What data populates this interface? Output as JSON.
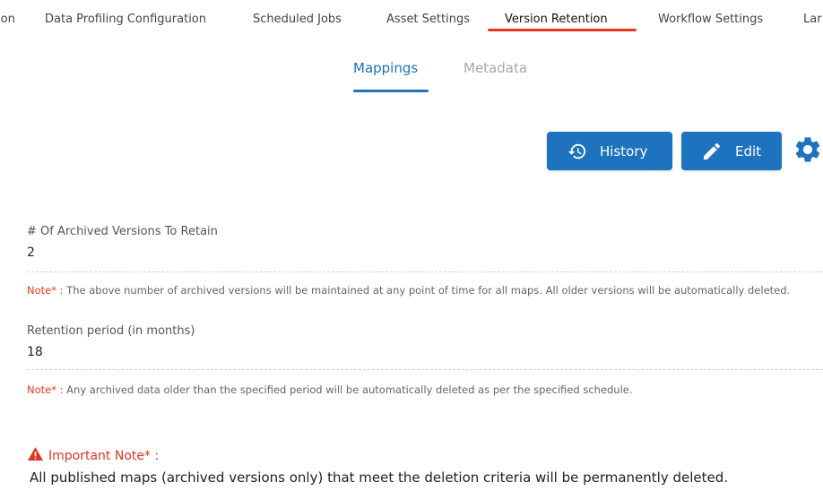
{
  "top_tabs": [
    {
      "label": "ion",
      "active": false
    },
    {
      "label": "Data Profiling Configuration",
      "active": false
    },
    {
      "label": "Scheduled Jobs",
      "active": false
    },
    {
      "label": "Asset Settings",
      "active": false
    },
    {
      "label": "Version Retention",
      "active": true
    },
    {
      "label": "Workflow Settings",
      "active": false
    },
    {
      "label": "Lar",
      "active": false
    }
  ],
  "sub_tabs": [
    {
      "label": "Mappings",
      "active": true
    },
    {
      "label": "Metadata",
      "active": false
    }
  ],
  "toolbar": {
    "history_label": "History",
    "edit_label": "Edit",
    "history_icon": "history-icon",
    "edit_icon": "pencil-icon",
    "settings_icon": "gear-icon"
  },
  "fields": {
    "archived_versions": {
      "label": "# Of Archived Versions To Retain",
      "value": "2"
    },
    "retention_period": {
      "label": "Retention period (in months)",
      "value": "18"
    }
  },
  "notes": {
    "prefix": "Note* :",
    "note1": "The above number of archived versions will be maintained at any point of time for all maps. All older versions will be automatically deleted.",
    "note2": "Any archived data older than the specified period will be automatically deleted as per the specified schedule."
  },
  "important": {
    "icon": "warning-icon",
    "title": "Important Note* :",
    "text": "All published maps (archived versions only) that meet the deletion criteria will be permanently deleted."
  },
  "colors": {
    "primary": "#1e73be",
    "active_tab_underline": "#e8391f",
    "note_label": "#e8391f",
    "important": "#e0341b"
  }
}
